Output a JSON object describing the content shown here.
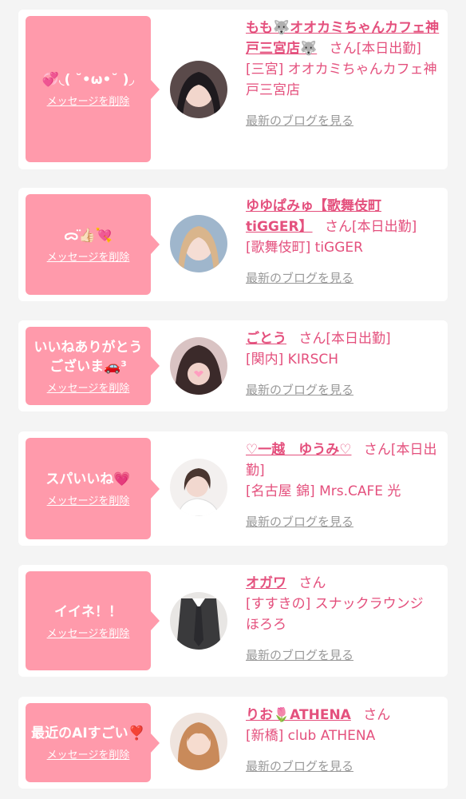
{
  "common": {
    "delete_label": "メッセージを削除",
    "blog_label": "最新のブログを見る",
    "san": "さん"
  },
  "cards": [
    {
      "message": "💞◟( ˘•ω•˘ )◞",
      "name": "もも🐺オオカミちゃんカフェ神戸三宮店🐺",
      "status": "[本日出勤]",
      "shop": "[三宮] オオカミちゃんカフェ神戸三宮店"
    },
    {
      "message": "ᯅ̈👍🏻💘",
      "name": "ゆゆぱみゅ【歌舞伎町tiGGER】",
      "status": "[本日出勤]",
      "shop": "[歌舞伎町] tiGGER"
    },
    {
      "message": "いいねありがとうございま🚗³",
      "name": "ごとう",
      "status": "[本日出勤]",
      "shop": "[関内] KIRSCH"
    },
    {
      "message": "スパいいね💗",
      "name": "♡一越　ゆうみ♡",
      "status": "[本日出勤]",
      "shop": "[名古屋 錦] Mrs.CAFE 光"
    },
    {
      "message": "イイネ！！",
      "name": "オガワ",
      "status": "",
      "shop": "[すすきの] スナックラウンジ　ほろろ"
    },
    {
      "message": "最近のAIすごい❣️",
      "name": "りお🌷ATHENA",
      "status": "",
      "shop": "[新橋] club ATHENA"
    }
  ],
  "colors": {
    "bubble": "#ff9aab",
    "accent": "#e4507d",
    "muted": "#999999"
  }
}
